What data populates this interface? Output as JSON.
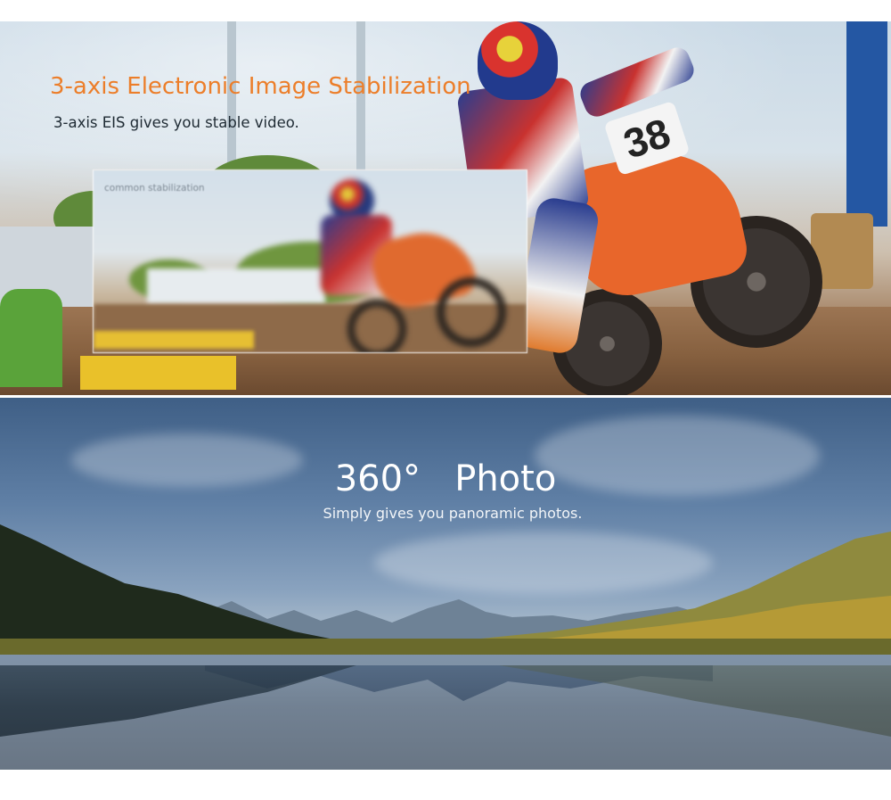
{
  "eis_section": {
    "title": "3-axis Electronic Image Stabilization",
    "subtitle": "3-axis EIS gives you stable video.",
    "inset_label": "common stabilization",
    "rider_number": "38",
    "accent_color": "#ec7e2a"
  },
  "panorama_section": {
    "title": "360°   Photo",
    "subtitle": "Simply gives you panoramic photos."
  }
}
